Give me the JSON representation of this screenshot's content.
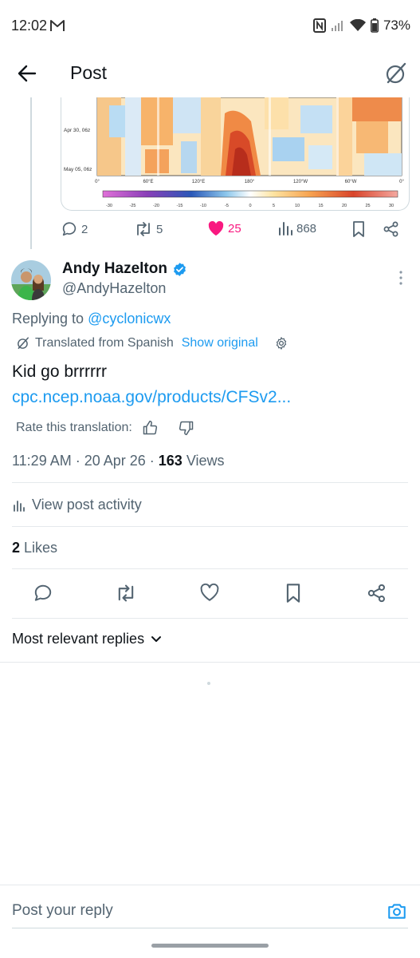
{
  "status_bar": {
    "time": "12:02",
    "battery": "73%"
  },
  "header": {
    "title": "Post"
  },
  "embed_chart": {
    "y_ticks": [
      "Apr 30, 06z",
      "May 05, 06z"
    ],
    "x_ticks": [
      "0°",
      "60°E",
      "120°E",
      "180°",
      "120°W",
      "60°W",
      "0°"
    ],
    "colorbar_ticks": [
      "-30",
      "-25",
      "-20",
      "-15",
      "-10",
      "-5",
      "0",
      "5",
      "10",
      "15",
      "20",
      "25",
      "30"
    ]
  },
  "parent_actions": {
    "replies": "2",
    "reposts": "5",
    "likes": "25",
    "views": "868"
  },
  "author": {
    "name": "Andy Hazelton",
    "handle": "@AndyHazelton"
  },
  "replying": {
    "prefix": "Replying to ",
    "mention": "@cyclonicwx"
  },
  "translation": {
    "label": "Translated from Spanish",
    "show_original": "Show original"
  },
  "tweet": {
    "text": "Kid go brrrrrr",
    "link": "cpc.ncep.noaa.gov/products/CFSv2..."
  },
  "rate": {
    "label": "Rate this translation:"
  },
  "meta": {
    "time_date": "11:29 AM · 20 Apr 26 · ",
    "views_count": "163",
    "views_label": " Views"
  },
  "activity": {
    "label": "View post activity"
  },
  "likes": {
    "count": "2",
    "label": " Likes"
  },
  "replies_sort": {
    "label": "Most relevant replies"
  },
  "reply_bar": {
    "placeholder": "Post your reply"
  },
  "colors": {
    "accent": "#1d9bf0",
    "like": "#f91880",
    "text": "#0f1419",
    "muted": "#536471"
  }
}
